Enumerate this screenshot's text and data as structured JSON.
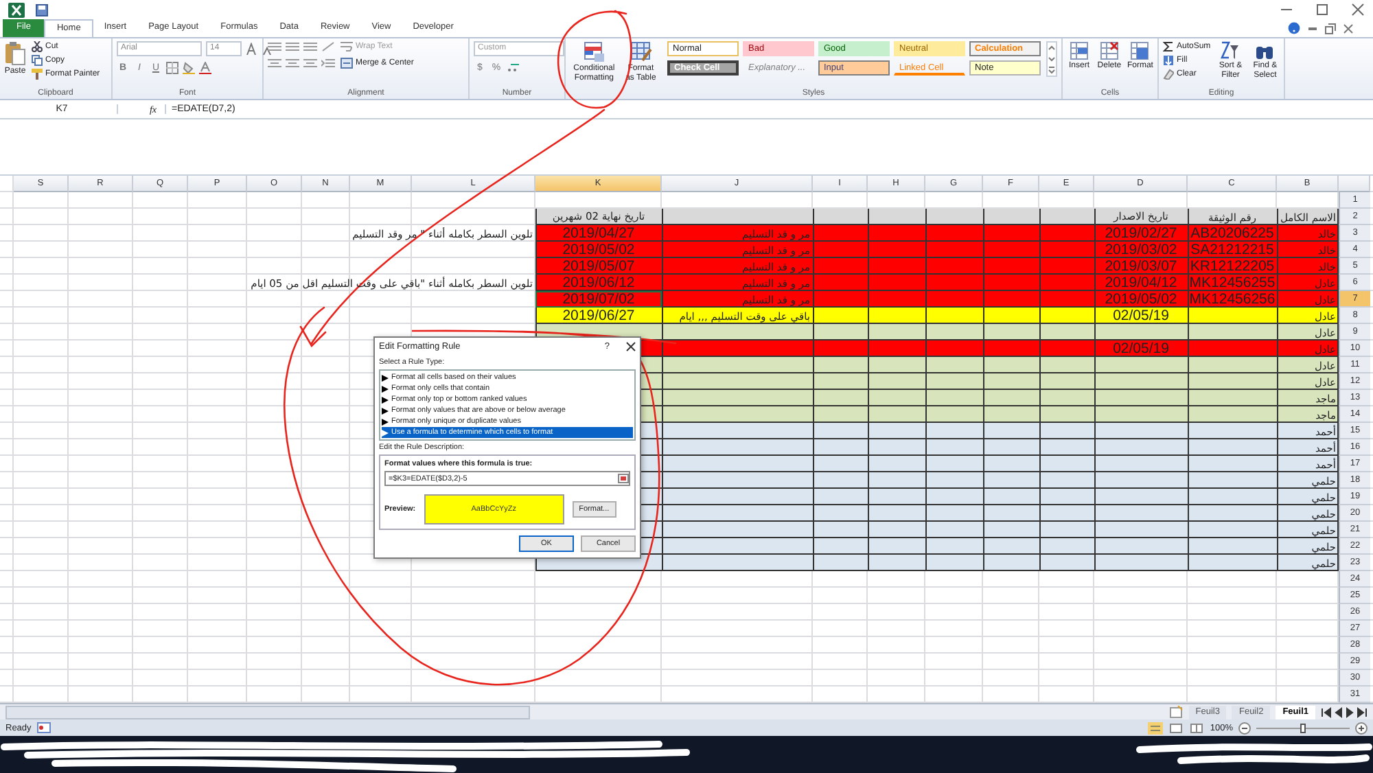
{
  "ribbon_tabs": [
    {
      "label": "File",
      "kind": "file",
      "selected": false
    },
    {
      "label": "Home",
      "kind": "tab",
      "selected": true
    },
    {
      "label": "Insert",
      "kind": "tab",
      "selected": false
    },
    {
      "label": "Page Layout",
      "kind": "tab",
      "selected": false
    },
    {
      "label": "Formulas",
      "kind": "tab",
      "selected": false
    },
    {
      "label": "Data",
      "kind": "tab",
      "selected": false
    },
    {
      "label": "Review",
      "kind": "tab",
      "selected": false
    },
    {
      "label": "View",
      "kind": "tab",
      "selected": false
    },
    {
      "label": "Developer",
      "kind": "tab",
      "selected": false
    }
  ],
  "ribbon": {
    "clipboard": {
      "paste": "Paste",
      "cut": "Cut",
      "copy": "Copy",
      "format_painter": "Format Painter",
      "label": "Clipboard"
    },
    "font": {
      "font_name": "Arial",
      "font_size": "14",
      "buttons": [
        "B",
        "I",
        "U"
      ],
      "label": "Font"
    },
    "alignment": {
      "wrap_text": "Wrap Text",
      "merge": "Merge & Center",
      "label": "Alignment"
    },
    "number": {
      "format": "Custom",
      "symbols": [
        "$",
        "%"
      ],
      "label": "Number"
    },
    "conditional_formatting": "Conditional Formatting",
    "format_as_table": "Format as Table",
    "styles": {
      "items": [
        {
          "label": "Normal",
          "kind": "normal"
        },
        {
          "label": "Bad",
          "kind": "bad"
        },
        {
          "label": "Good",
          "kind": "good"
        },
        {
          "label": "Neutral",
          "kind": "neutral"
        },
        {
          "label": "Calculation",
          "kind": "calculation"
        },
        {
          "label": "Check Cell",
          "kind": "check"
        },
        {
          "label": "Explanatory ...",
          "kind": "explanatory"
        },
        {
          "label": "Input",
          "kind": "input"
        },
        {
          "label": "Linked Cell",
          "kind": "linked"
        },
        {
          "label": "Note",
          "kind": "note"
        }
      ],
      "label": "Styles"
    },
    "cells": {
      "buttons": [
        "Insert",
        "Delete",
        "Format"
      ],
      "label": "Cells"
    },
    "editing": {
      "autosum": "AutoSum",
      "fill": "Fill",
      "clear": "Clear",
      "sort": "Sort & Filter",
      "find": "Find & Select",
      "label": "Editing"
    }
  },
  "formula_bar": {
    "name_box": "K7",
    "fx": "fx",
    "formula": "=EDATE(D7,2)"
  },
  "sheet": {
    "columns": [
      {
        "letter": "S",
        "selected": false
      },
      {
        "letter": "R",
        "selected": false
      },
      {
        "letter": "Q",
        "selected": false
      },
      {
        "letter": "P",
        "selected": false
      },
      {
        "letter": "O",
        "selected": false
      },
      {
        "letter": "N",
        "selected": false
      },
      {
        "letter": "M",
        "selected": false
      },
      {
        "letter": "L",
        "selected": false
      },
      {
        "letter": "K",
        "selected": true
      },
      {
        "letter": "J",
        "selected": false
      },
      {
        "letter": "I",
        "selected": false
      },
      {
        "letter": "H",
        "selected": false
      },
      {
        "letter": "G",
        "selected": false
      },
      {
        "letter": "F",
        "selected": false
      },
      {
        "letter": "E",
        "selected": false
      },
      {
        "letter": "D",
        "selected": false
      },
      {
        "letter": "C",
        "selected": false
      },
      {
        "letter": "B",
        "selected": false
      }
    ],
    "rows": [
      {
        "number": "1",
        "selected": false
      },
      {
        "number": "2",
        "selected": false,
        "color": "#d9d9d9",
        "cells": {
          "K": "تاريخ نهاية 02 شهرين",
          "D": "تاريخ الاصدار",
          "C": "رقم الوثيقة",
          "B": "الاسم الكامل"
        }
      },
      {
        "number": "3",
        "selected": false,
        "color": "#ff0000",
        "cells": {
          "L": "تلوين السطر بكامله أثناء \" مر وقد التسليم",
          "K": "2019/04/27",
          "J": "مر و قد التسليم",
          "D": "2019/02/27",
          "C": "AB20206225",
          "B": "خالد"
        }
      },
      {
        "number": "4",
        "selected": false,
        "color": "#ff0000",
        "cells": {
          "K": "2019/05/02",
          "J": "مر و قد التسليم",
          "D": "2019/03/02",
          "C": "SA21212215",
          "B": "خالد"
        }
      },
      {
        "number": "5",
        "selected": false,
        "color": "#ff0000",
        "cells": {
          "K": "2019/05/07",
          "J": "مر و قد التسليم",
          "D": "2019/03/07",
          "C": "KR12122205",
          "B": "خالد"
        }
      },
      {
        "number": "6",
        "selected": false,
        "color": "#ff0000",
        "cells": {
          "L": "تلوين السطر بكامله أثناء \"باقي على وقت التسليم اقل من 05 ايام",
          "K": "2019/06/12",
          "J": "مر و قد التسليم",
          "D": "2019/04/12",
          "C": "MK12456255",
          "B": "عادل"
        }
      },
      {
        "number": "7",
        "selected": true,
        "color": "#ff0000",
        "cells": {
          "K": "2019/07/02",
          "J": "مر و قد التسليم",
          "D": "2019/05/02",
          "C": "MK12456256",
          "B": "عادل"
        }
      },
      {
        "number": "8",
        "selected": false,
        "color": "#ffff00",
        "cells": {
          "K": "2019/06/27",
          "J": "باقي على وقت التسليم ,,, ايام",
          "D": "02/05/19",
          "B": "عادل"
        }
      },
      {
        "number": "9",
        "selected": false,
        "color": "#d8e4bc",
        "cells": {
          "B": "عادل"
        }
      },
      {
        "number": "10",
        "selected": false,
        "color": "#ff0000",
        "cells": {
          "D": "02/05/19",
          "B": "عادل"
        }
      },
      {
        "number": "11",
        "selected": false,
        "color": "#d8e4bc",
        "cells": {
          "B": "عادل"
        }
      },
      {
        "number": "12",
        "selected": false,
        "color": "#d8e4bc",
        "cells": {
          "B": "عادل"
        }
      },
      {
        "number": "13",
        "selected": false,
        "color": "#d8e4bc",
        "cells": {
          "B": "ماجد"
        }
      },
      {
        "number": "14",
        "selected": false,
        "color": "#d8e4bc",
        "cells": {
          "B": "ماجد"
        }
      },
      {
        "number": "15",
        "selected": false,
        "color": "#dce6f1",
        "cells": {
          "B": "أحمد"
        }
      },
      {
        "number": "16",
        "selected": false,
        "color": "#dce6f1",
        "cells": {
          "B": "أحمد"
        }
      },
      {
        "number": "17",
        "selected": false,
        "color": "#dce6f1",
        "cells": {
          "B": "أحمد"
        }
      },
      {
        "number": "18",
        "selected": false,
        "color": "#dce6f1",
        "cells": {
          "B": "حلمي"
        }
      },
      {
        "number": "19",
        "selected": false,
        "color": "#dce6f1",
        "cells": {
          "B": "حلمي"
        }
      },
      {
        "number": "20",
        "selected": false,
        "color": "#dce6f1",
        "cells": {
          "B": "حلمي"
        }
      },
      {
        "number": "21",
        "selected": false,
        "color": "#dce6f1",
        "cells": {
          "B": "حلمي"
        }
      },
      {
        "number": "22",
        "selected": false,
        "color": "#dce6f1",
        "cells": {
          "B": "حلمي"
        }
      },
      {
        "number": "23",
        "selected": false,
        "color": "#dce6f1",
        "cells": {
          "B": "حلمي"
        }
      },
      {
        "number": "24",
        "selected": false
      },
      {
        "number": "25",
        "selected": false
      },
      {
        "number": "26",
        "selected": false
      },
      {
        "number": "27",
        "selected": false
      },
      {
        "number": "28",
        "selected": false
      },
      {
        "number": "29",
        "selected": false
      },
      {
        "number": "30",
        "selected": false
      },
      {
        "number": "31",
        "selected": false
      }
    ]
  },
  "sheet_tabs": [
    {
      "label": "Feuil3",
      "selected": false
    },
    {
      "label": "Feuil2",
      "selected": false
    },
    {
      "label": "Feuil1",
      "selected": true
    }
  ],
  "status_bar": {
    "status": "Ready",
    "zoom": "100%",
    "zoom_slider": {
      "level": 0.5
    }
  },
  "dialog": {
    "title": "Edit Formatting Rule",
    "help": "?",
    "select_label": "Select a Rule Type:",
    "rule_types": [
      {
        "label": "Format all cells based on their values",
        "selected": false
      },
      {
        "label": "Format only cells that contain",
        "selected": false
      },
      {
        "label": "Format only top or bottom ranked values",
        "selected": false
      },
      {
        "label": "Format only values that are above or below average",
        "selected": false
      },
      {
        "label": "Format only unique or duplicate values",
        "selected": false
      },
      {
        "label": "Use a formula to determine which cells to format",
        "selected": true
      }
    ],
    "description_label": "Edit the Rule Description:",
    "formula_label": "Format values where this formula is true:",
    "formula": "=$K3=EDATE($D3,2)-5",
    "preview_label": "Preview:",
    "preview_sample": "AaBbCcYyZz",
    "format_button": "Format...",
    "ok": "OK",
    "cancel": "Cancel"
  }
}
